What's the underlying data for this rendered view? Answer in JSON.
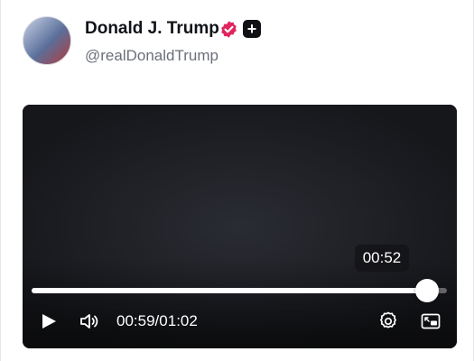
{
  "post": {
    "author": {
      "display_name": "Donald J. Trump",
      "handle": "@realDonaldTrump",
      "verified": true,
      "avatar_icon": "avatar"
    },
    "follow_icon": "plus-icon",
    "follow_glyph": "+"
  },
  "video": {
    "content": "not reproduced",
    "hover_time": "00:52",
    "current_time": "00:59",
    "time_separator": "/",
    "duration": "01:02",
    "progress_fraction": 0.952,
    "controls": {
      "play_icon": "play-icon",
      "volume_icon": "volume-icon",
      "settings_icon": "gear-icon",
      "pip_icon": "picture-in-picture-icon"
    }
  },
  "colors": {
    "badge": "#e0245e",
    "text_primary": "#111318",
    "text_secondary": "#6b6f7a"
  }
}
